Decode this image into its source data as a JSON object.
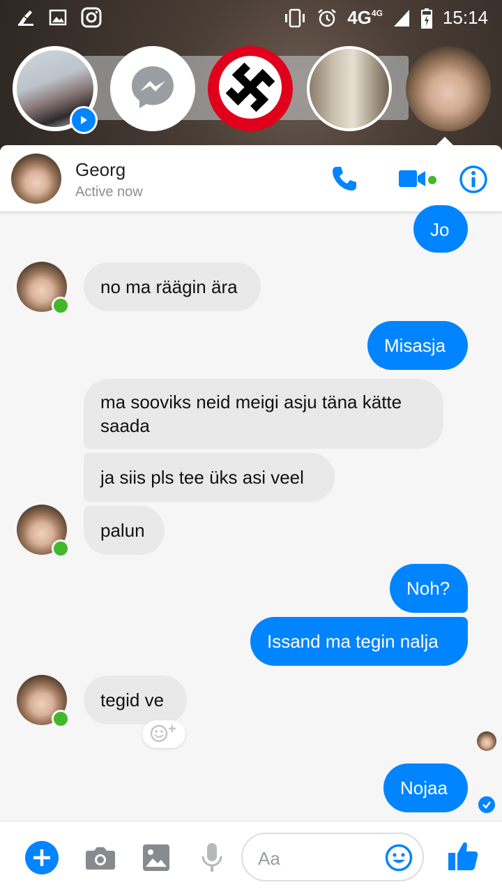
{
  "status_bar": {
    "network": "4G",
    "network_small": "4G",
    "time": "15:14"
  },
  "chat_heads": [
    {
      "icon": "photo-avatar",
      "badge": "play-icon"
    },
    {
      "icon": "messenger-icon"
    },
    {
      "icon": "red-symbol-avatar"
    },
    {
      "icon": "photo-avatar"
    },
    {
      "icon": "photo-avatar",
      "active": true
    }
  ],
  "header": {
    "name": "Georg",
    "status": "Active now",
    "accent": "#0084ff",
    "online_color": "#42b72a"
  },
  "messages": [
    {
      "from": "me",
      "text": "Jo"
    },
    {
      "from": "them",
      "text": "no ma räägin ära"
    },
    {
      "from": "me",
      "text": "Misasja"
    },
    {
      "from": "them",
      "text": "ma sooviks neid meigi asju täna kätte saada"
    },
    {
      "from": "them",
      "text": "ja siis pls tee üks asi veel"
    },
    {
      "from": "them",
      "text": "palun"
    },
    {
      "from": "me",
      "text": "Noh?"
    },
    {
      "from": "me",
      "text": "Issand ma tegin nalja"
    },
    {
      "from": "them",
      "text": "tegid ve"
    },
    {
      "from": "me",
      "text": "Nojaa"
    }
  ],
  "composer": {
    "placeholder": "Aa",
    "icons": [
      "plus-icon",
      "camera-icon",
      "gallery-icon",
      "microphone-icon",
      "emoji-icon",
      "thumbs-up-icon"
    ]
  }
}
